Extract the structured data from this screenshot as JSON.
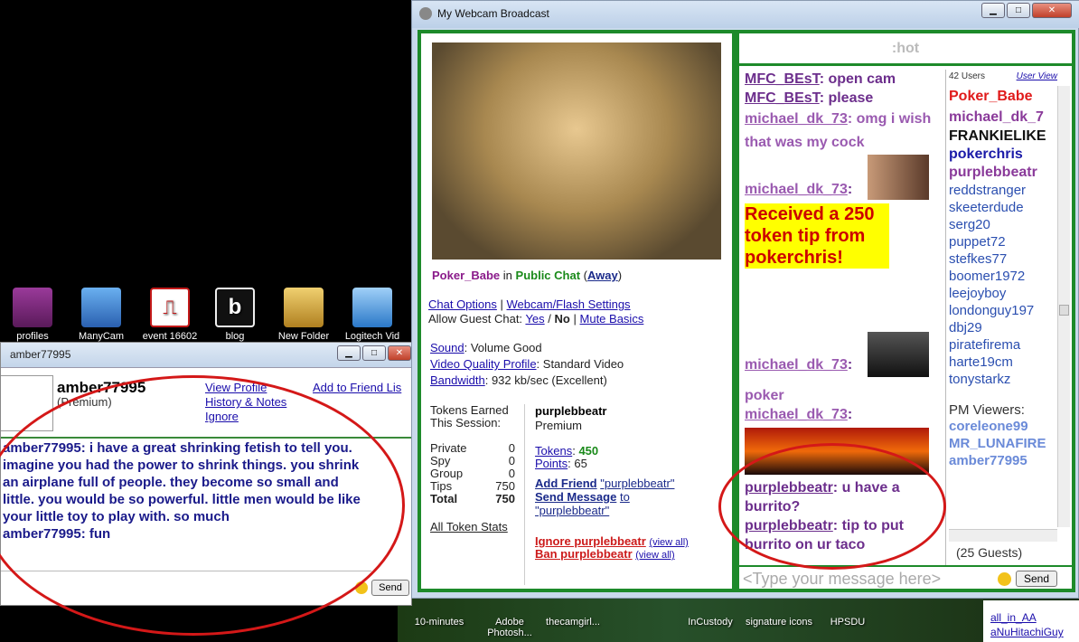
{
  "desktop": {
    "icons": [
      {
        "label": "profiles",
        "color": "#7a2a7a"
      },
      {
        "label": "ManyCam",
        "color": "#3a78c8"
      },
      {
        "label": "event 16602",
        "color": "#c41a1a"
      },
      {
        "label": "blog",
        "color": "#222"
      },
      {
        "label": "New Folder",
        "color": "#c8a040"
      },
      {
        "label": "Logitech Vid",
        "color": "#3a88d8"
      }
    ],
    "bottom_icons": [
      "10-minutes",
      "Adobe Photosh...",
      "thecamgirl...",
      "InCustody",
      "signature icons",
      "HPSDU"
    ],
    "right_links": [
      "all_in_AA",
      "aNuHitachiGuy"
    ]
  },
  "amber_window": {
    "title": "amber77995",
    "username": "amber77995",
    "status": "(Premium)",
    "links": {
      "view_profile": "View Profile",
      "history": "History & Notes",
      "ignore": "Ignore",
      "add_friend": "Add to Friend Lis"
    },
    "chat": [
      "amber77995: i have a great shrinking fetish to tell you.",
      "imagine you had the power to shrink things. you shrink",
      "an airplane full of people. they become so small and",
      "little. you would be so powerful. little men would be like",
      "your little toy to play with. so much",
      "amber77995: fun"
    ],
    "send_label": "Send"
  },
  "webcam": {
    "title": "My Webcam Broadcast",
    "broadcaster": "Poker_Babe",
    "in_word": "in",
    "room": "Public Chat",
    "status": "Away",
    "chat_options": "Chat Options",
    "separator": "|",
    "webcam_settings": "Webcam/Flash Settings",
    "guest_chat_label": "Allow Guest Chat:",
    "guest_yes": "Yes",
    "slash": "/",
    "guest_no": "No",
    "mute_basics": "Mute Basics",
    "sound_label": "Sound",
    "sound_value": ": Volume Good",
    "video_label": "Video Quality Profile",
    "video_value": ": Standard Video",
    "bandwidth_label": "Bandwidth",
    "bandwidth_value": ": 932 kb/sec (Excellent)",
    "tokens_earned_label": "Tokens Earned This Session:",
    "session_rows": [
      {
        "label": "Private",
        "value": "0"
      },
      {
        "label": "Spy",
        "value": "0"
      },
      {
        "label": "Group",
        "value": "0"
      },
      {
        "label": "Tips",
        "value": "750"
      },
      {
        "label": "Total",
        "value": "750"
      }
    ],
    "all_token_stats": "All Token Stats",
    "selected_user": "purplebbeatr",
    "selected_status": "Premium",
    "tokens_label": "Tokens",
    "tokens_value": "450",
    "points_label": "Points",
    "points_value": "65",
    "add_friend": "Add Friend",
    "send_message": "Send Message",
    "to_word": "to",
    "quoted_user": "\"purplebbeatr\"",
    "ignore_user": "Ignore purplebbeatr",
    "ban_user": "Ban purplebbeatr",
    "view_all": "(view all)",
    "room_topic": ":hot",
    "messages": [
      {
        "name": "MFC_BEsT",
        "text": ": open cam"
      },
      {
        "name": "MFC_BEsT",
        "text": ": please"
      },
      {
        "name": "michael_dk_73",
        "text": ": omg i wish that was my cock"
      },
      {
        "name": "michael_dk_73",
        "text": ":"
      },
      {
        "name": "",
        "text": "Received a 250 token tip from pokerchris!"
      },
      {
        "name": "michael_dk_73",
        "text": ":"
      },
      {
        "name": "",
        "text": "poker"
      },
      {
        "name": "michael_dk_73",
        "text": ":"
      },
      {
        "name": "purplebbeatr",
        "text": ": u have a burrito?"
      },
      {
        "name": "purplebbeatr",
        "text": ": tip to put burrito on ur taco"
      }
    ],
    "user_count": "42 Users",
    "user_view": "User View",
    "users": [
      "Poker_Babe",
      "michael_dk_7",
      "FRANKIELIKE",
      "pokerchris",
      "purplebbeatr",
      "reddstranger",
      "skeeterdude",
      "serg20",
      "puppet72",
      "stefkes77",
      "boomer1972",
      "leejoyboy",
      "londonguy197",
      "dbj29",
      "piratefirema",
      "harte19cm",
      "tonystarkz"
    ],
    "pm_viewers_label": "PM Viewers:",
    "pm_viewers": [
      "coreleone99",
      "MR_LUNAFIRE",
      "amber77995"
    ],
    "guests": "(25 Guests)",
    "input_placeholder": "<Type your message here>",
    "send_label": "Send",
    "colors": {
      "frame_green": "#1d8a2a",
      "tip_yellow": "#ffff00",
      "tip_red": "#cc0000",
      "msg_purple": "#6c2e8c",
      "user_blue": "#2b4fb0"
    }
  }
}
